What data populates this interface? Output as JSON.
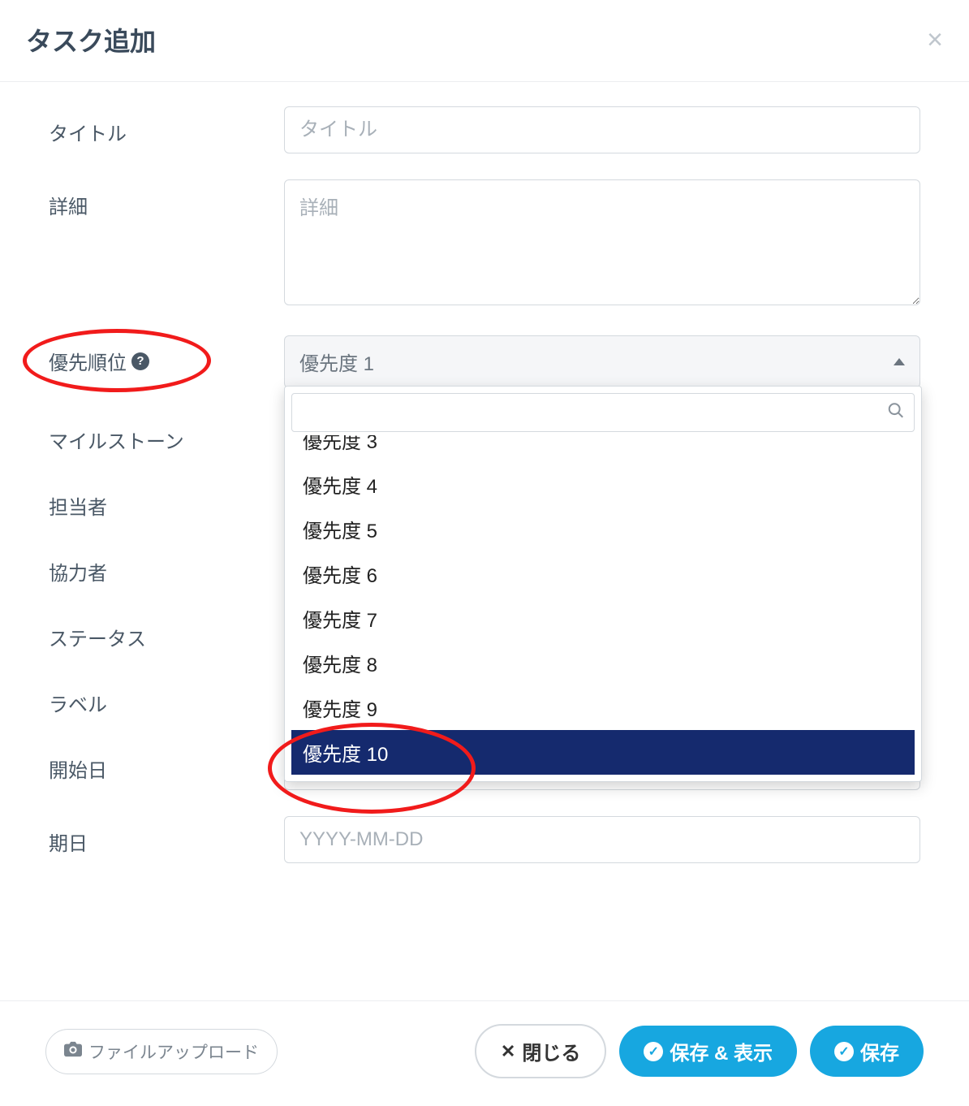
{
  "header": {
    "title": "タスク追加"
  },
  "labels": {
    "title": "タイトル",
    "detail": "詳細",
    "priority": "優先順位",
    "milestone": "マイルストーン",
    "assignee": "担当者",
    "collaborator": "協力者",
    "status": "ステータス",
    "label": "ラベル",
    "start_date": "開始日",
    "due_date": "期日"
  },
  "placeholders": {
    "title": "タイトル",
    "detail": "詳細",
    "date": "YYYY-MM-DD"
  },
  "priority": {
    "selected": "優先度 1",
    "options": {
      "o3_clipped": "優先度 3",
      "o4": "優先度 4",
      "o5": "優先度 5",
      "o6": "優先度 6",
      "o7": "優先度 7",
      "o8": "優先度 8",
      "o9": "優先度 9",
      "o10": "優先度 10"
    }
  },
  "footer": {
    "upload": "ファイルアップロード",
    "close": "閉じる",
    "save_show": "保存 & 表示",
    "save": "保存"
  }
}
